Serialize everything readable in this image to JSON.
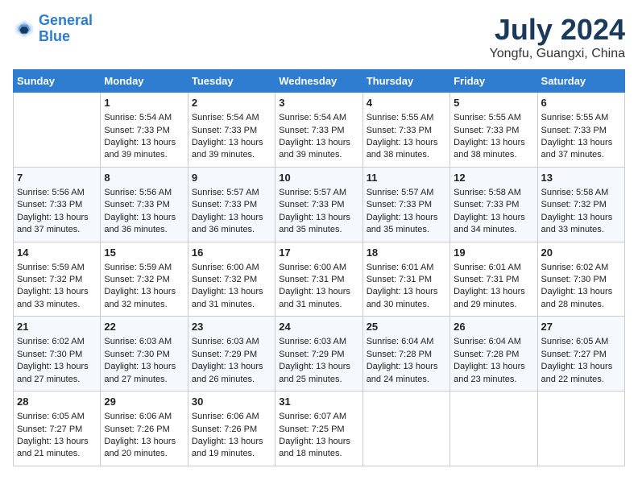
{
  "header": {
    "logo_line1": "General",
    "logo_line2": "Blue",
    "main_title": "July 2024",
    "sub_title": "Yongfu, Guangxi, China"
  },
  "weekdays": [
    "Sunday",
    "Monday",
    "Tuesday",
    "Wednesday",
    "Thursday",
    "Friday",
    "Saturday"
  ],
  "weeks": [
    [
      {
        "day": "",
        "data": ""
      },
      {
        "day": "1",
        "data": "Sunrise: 5:54 AM\nSunset: 7:33 PM\nDaylight: 13 hours and 39 minutes."
      },
      {
        "day": "2",
        "data": "Sunrise: 5:54 AM\nSunset: 7:33 PM\nDaylight: 13 hours and 39 minutes."
      },
      {
        "day": "3",
        "data": "Sunrise: 5:54 AM\nSunset: 7:33 PM\nDaylight: 13 hours and 39 minutes."
      },
      {
        "day": "4",
        "data": "Sunrise: 5:55 AM\nSunset: 7:33 PM\nDaylight: 13 hours and 38 minutes."
      },
      {
        "day": "5",
        "data": "Sunrise: 5:55 AM\nSunset: 7:33 PM\nDaylight: 13 hours and 38 minutes."
      },
      {
        "day": "6",
        "data": "Sunrise: 5:55 AM\nSunset: 7:33 PM\nDaylight: 13 hours and 37 minutes."
      }
    ],
    [
      {
        "day": "7",
        "data": "Sunrise: 5:56 AM\nSunset: 7:33 PM\nDaylight: 13 hours and 37 minutes."
      },
      {
        "day": "8",
        "data": "Sunrise: 5:56 AM\nSunset: 7:33 PM\nDaylight: 13 hours and 36 minutes."
      },
      {
        "day": "9",
        "data": "Sunrise: 5:57 AM\nSunset: 7:33 PM\nDaylight: 13 hours and 36 minutes."
      },
      {
        "day": "10",
        "data": "Sunrise: 5:57 AM\nSunset: 7:33 PM\nDaylight: 13 hours and 35 minutes."
      },
      {
        "day": "11",
        "data": "Sunrise: 5:57 AM\nSunset: 7:33 PM\nDaylight: 13 hours and 35 minutes."
      },
      {
        "day": "12",
        "data": "Sunrise: 5:58 AM\nSunset: 7:33 PM\nDaylight: 13 hours and 34 minutes."
      },
      {
        "day": "13",
        "data": "Sunrise: 5:58 AM\nSunset: 7:32 PM\nDaylight: 13 hours and 33 minutes."
      }
    ],
    [
      {
        "day": "14",
        "data": "Sunrise: 5:59 AM\nSunset: 7:32 PM\nDaylight: 13 hours and 33 minutes."
      },
      {
        "day": "15",
        "data": "Sunrise: 5:59 AM\nSunset: 7:32 PM\nDaylight: 13 hours and 32 minutes."
      },
      {
        "day": "16",
        "data": "Sunrise: 6:00 AM\nSunset: 7:32 PM\nDaylight: 13 hours and 31 minutes."
      },
      {
        "day": "17",
        "data": "Sunrise: 6:00 AM\nSunset: 7:31 PM\nDaylight: 13 hours and 31 minutes."
      },
      {
        "day": "18",
        "data": "Sunrise: 6:01 AM\nSunset: 7:31 PM\nDaylight: 13 hours and 30 minutes."
      },
      {
        "day": "19",
        "data": "Sunrise: 6:01 AM\nSunset: 7:31 PM\nDaylight: 13 hours and 29 minutes."
      },
      {
        "day": "20",
        "data": "Sunrise: 6:02 AM\nSunset: 7:30 PM\nDaylight: 13 hours and 28 minutes."
      }
    ],
    [
      {
        "day": "21",
        "data": "Sunrise: 6:02 AM\nSunset: 7:30 PM\nDaylight: 13 hours and 27 minutes."
      },
      {
        "day": "22",
        "data": "Sunrise: 6:03 AM\nSunset: 7:30 PM\nDaylight: 13 hours and 27 minutes."
      },
      {
        "day": "23",
        "data": "Sunrise: 6:03 AM\nSunset: 7:29 PM\nDaylight: 13 hours and 26 minutes."
      },
      {
        "day": "24",
        "data": "Sunrise: 6:03 AM\nSunset: 7:29 PM\nDaylight: 13 hours and 25 minutes."
      },
      {
        "day": "25",
        "data": "Sunrise: 6:04 AM\nSunset: 7:28 PM\nDaylight: 13 hours and 24 minutes."
      },
      {
        "day": "26",
        "data": "Sunrise: 6:04 AM\nSunset: 7:28 PM\nDaylight: 13 hours and 23 minutes."
      },
      {
        "day": "27",
        "data": "Sunrise: 6:05 AM\nSunset: 7:27 PM\nDaylight: 13 hours and 22 minutes."
      }
    ],
    [
      {
        "day": "28",
        "data": "Sunrise: 6:05 AM\nSunset: 7:27 PM\nDaylight: 13 hours and 21 minutes."
      },
      {
        "day": "29",
        "data": "Sunrise: 6:06 AM\nSunset: 7:26 PM\nDaylight: 13 hours and 20 minutes."
      },
      {
        "day": "30",
        "data": "Sunrise: 6:06 AM\nSunset: 7:26 PM\nDaylight: 13 hours and 19 minutes."
      },
      {
        "day": "31",
        "data": "Sunrise: 6:07 AM\nSunset: 7:25 PM\nDaylight: 13 hours and 18 minutes."
      },
      {
        "day": "",
        "data": ""
      },
      {
        "day": "",
        "data": ""
      },
      {
        "day": "",
        "data": ""
      }
    ]
  ]
}
